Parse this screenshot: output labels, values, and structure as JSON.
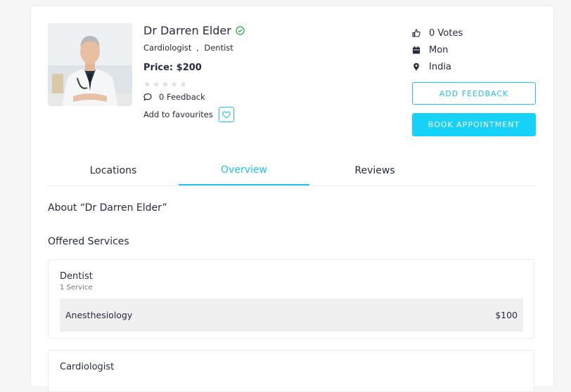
{
  "doctor": {
    "name": "Dr Darren Elder",
    "specialities": [
      "Cardiologist",
      "Dentist"
    ],
    "specialities_sep": ",",
    "price": "Price: $200",
    "rating": 0,
    "rating_max": 5,
    "feedback": "0 Feedback",
    "favourites_label": "Add to favourites"
  },
  "info": {
    "votes": "0 Votes",
    "day": "Mon",
    "location": "India"
  },
  "buttons": {
    "add_feedback": "ADD FEEDBACK",
    "book_appointment": "BOOK APPOINTMENT"
  },
  "tabs": [
    {
      "label": "Locations",
      "active": false
    },
    {
      "label": "Overview",
      "active": true
    },
    {
      "label": "Reviews",
      "active": false
    }
  ],
  "overview": {
    "about_heading": "About “Dr Darren Elder”",
    "offered_heading": "Offered Services",
    "services": [
      {
        "category": "Dentist",
        "count": "1 Service",
        "items": [
          {
            "name": "Anesthesiology",
            "price": "$100"
          }
        ]
      },
      {
        "category": "Cardiologist"
      }
    ]
  },
  "colors": {
    "accent": "#20c0f3",
    "button_fill": "#16d2f9",
    "verified": "#28a745"
  }
}
